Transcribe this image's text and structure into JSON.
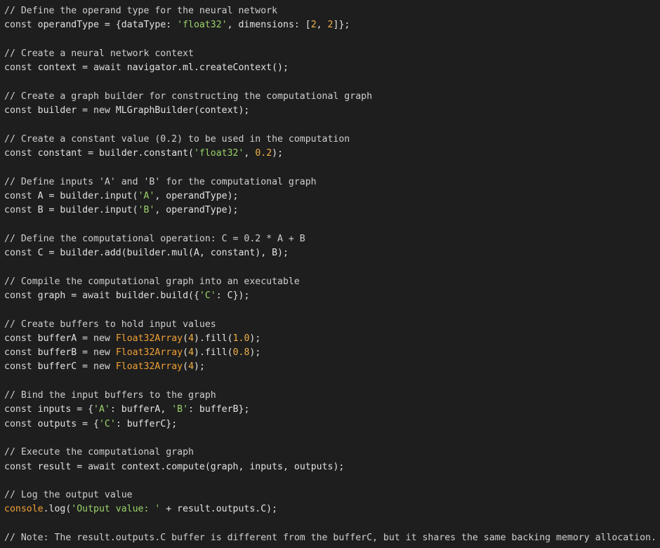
{
  "editor": {
    "theme_colors": {
      "background": "#1e1e1e",
      "comment": "#cfcfcf",
      "keyword": "#d8d8d8",
      "string": "#9bd36a",
      "number": "#f0b04a",
      "type": "#f0a035",
      "identifier": "#e2e2e2"
    },
    "lines": [
      [
        {
          "t": "c",
          "v": "// Define the operand type for the neural network"
        }
      ],
      [
        {
          "t": "k",
          "v": "const"
        },
        {
          "t": "x",
          "v": " operandType = {dataType: "
        },
        {
          "t": "s",
          "v": "'float32'"
        },
        {
          "t": "x",
          "v": ", dimensions: ["
        },
        {
          "t": "n",
          "v": "2"
        },
        {
          "t": "x",
          "v": ", "
        },
        {
          "t": "n",
          "v": "2"
        },
        {
          "t": "x",
          "v": "]};"
        }
      ],
      [],
      [
        {
          "t": "c",
          "v": "// Create a neural network context"
        }
      ],
      [
        {
          "t": "k",
          "v": "const"
        },
        {
          "t": "x",
          "v": " context = "
        },
        {
          "t": "k",
          "v": "await"
        },
        {
          "t": "x",
          "v": " navigator.ml.createContext();"
        }
      ],
      [],
      [
        {
          "t": "c",
          "v": "// Create a graph builder for constructing the computational graph"
        }
      ],
      [
        {
          "t": "k",
          "v": "const"
        },
        {
          "t": "x",
          "v": " builder = "
        },
        {
          "t": "k",
          "v": "new"
        },
        {
          "t": "x",
          "v": " MLGraphBuilder(context);"
        }
      ],
      [],
      [
        {
          "t": "c",
          "v": "// Create a constant value (0.2) to be used in the computation"
        }
      ],
      [
        {
          "t": "k",
          "v": "const"
        },
        {
          "t": "x",
          "v": " constant = builder.constant("
        },
        {
          "t": "s",
          "v": "'float32'"
        },
        {
          "t": "x",
          "v": ", "
        },
        {
          "t": "n",
          "v": "0.2"
        },
        {
          "t": "x",
          "v": ");"
        }
      ],
      [],
      [
        {
          "t": "c",
          "v": "// Define inputs 'A' and 'B' for the computational graph"
        }
      ],
      [
        {
          "t": "k",
          "v": "const"
        },
        {
          "t": "x",
          "v": " A = builder.input("
        },
        {
          "t": "s",
          "v": "'A'"
        },
        {
          "t": "x",
          "v": ", operandType);"
        }
      ],
      [
        {
          "t": "k",
          "v": "const"
        },
        {
          "t": "x",
          "v": " B = builder.input("
        },
        {
          "t": "s",
          "v": "'B'"
        },
        {
          "t": "x",
          "v": ", operandType);"
        }
      ],
      [],
      [
        {
          "t": "c",
          "v": "// Define the computational operation: C = 0.2 * A + B"
        }
      ],
      [
        {
          "t": "k",
          "v": "const"
        },
        {
          "t": "x",
          "v": " C = builder.add(builder.mul(A, constant), B);"
        }
      ],
      [],
      [
        {
          "t": "c",
          "v": "// Compile the computational graph into an executable"
        }
      ],
      [
        {
          "t": "k",
          "v": "const"
        },
        {
          "t": "x",
          "v": " graph = "
        },
        {
          "t": "k",
          "v": "await"
        },
        {
          "t": "x",
          "v": " builder.build({"
        },
        {
          "t": "s",
          "v": "'C'"
        },
        {
          "t": "x",
          "v": ": C});"
        }
      ],
      [],
      [
        {
          "t": "c",
          "v": "// Create buffers to hold input values"
        }
      ],
      [
        {
          "t": "k",
          "v": "const"
        },
        {
          "t": "x",
          "v": " bufferA = "
        },
        {
          "t": "k",
          "v": "new"
        },
        {
          "t": "x",
          "v": " "
        },
        {
          "t": "y",
          "v": "Float32Array"
        },
        {
          "t": "x",
          "v": "("
        },
        {
          "t": "n",
          "v": "4"
        },
        {
          "t": "x",
          "v": ").fill("
        },
        {
          "t": "n",
          "v": "1.0"
        },
        {
          "t": "x",
          "v": ");"
        }
      ],
      [
        {
          "t": "k",
          "v": "const"
        },
        {
          "t": "x",
          "v": " bufferB = "
        },
        {
          "t": "k",
          "v": "new"
        },
        {
          "t": "x",
          "v": " "
        },
        {
          "t": "y",
          "v": "Float32Array"
        },
        {
          "t": "x",
          "v": "("
        },
        {
          "t": "n",
          "v": "4"
        },
        {
          "t": "x",
          "v": ").fill("
        },
        {
          "t": "n",
          "v": "0.8"
        },
        {
          "t": "x",
          "v": ");"
        }
      ],
      [
        {
          "t": "k",
          "v": "const"
        },
        {
          "t": "x",
          "v": " bufferC = "
        },
        {
          "t": "k",
          "v": "new"
        },
        {
          "t": "x",
          "v": " "
        },
        {
          "t": "y",
          "v": "Float32Array"
        },
        {
          "t": "x",
          "v": "("
        },
        {
          "t": "n",
          "v": "4"
        },
        {
          "t": "x",
          "v": ");"
        }
      ],
      [],
      [
        {
          "t": "c",
          "v": "// Bind the input buffers to the graph"
        }
      ],
      [
        {
          "t": "k",
          "v": "const"
        },
        {
          "t": "x",
          "v": " inputs = {"
        },
        {
          "t": "s",
          "v": "'A'"
        },
        {
          "t": "x",
          "v": ": bufferA, "
        },
        {
          "t": "s",
          "v": "'B'"
        },
        {
          "t": "x",
          "v": ": bufferB};"
        }
      ],
      [
        {
          "t": "k",
          "v": "const"
        },
        {
          "t": "x",
          "v": " outputs = {"
        },
        {
          "t": "s",
          "v": "'C'"
        },
        {
          "t": "x",
          "v": ": bufferC};"
        }
      ],
      [],
      [
        {
          "t": "c",
          "v": "// Execute the computational graph"
        }
      ],
      [
        {
          "t": "k",
          "v": "const"
        },
        {
          "t": "x",
          "v": " result = "
        },
        {
          "t": "k",
          "v": "await"
        },
        {
          "t": "x",
          "v": " context.compute(graph, inputs, outputs);"
        }
      ],
      [],
      [
        {
          "t": "c",
          "v": "// Log the output value"
        }
      ],
      [
        {
          "t": "y",
          "v": "console"
        },
        {
          "t": "x",
          "v": ".log("
        },
        {
          "t": "s",
          "v": "'Output value: '"
        },
        {
          "t": "x",
          "v": " + result.outputs.C);"
        }
      ],
      [],
      [
        {
          "t": "c",
          "v": "// Note: The result.outputs.C buffer is different from the bufferC, but it shares the same backing memory allocation."
        }
      ]
    ]
  }
}
